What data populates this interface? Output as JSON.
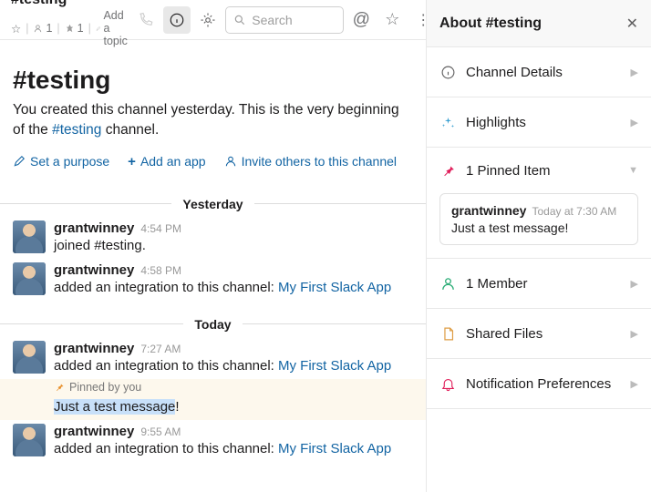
{
  "header": {
    "channel": "#testing",
    "members": "1",
    "pins": "1",
    "add_topic": "Add a topic",
    "search_ph": "Search"
  },
  "hero": {
    "title": "#testing",
    "line1": "You created this channel yesterday. This is the very beginning of the ",
    "chlink": "#testing",
    "line2": " channel.",
    "set_purpose": "Set a purpose",
    "add_app": "Add an app",
    "invite": "Invite others to this channel"
  },
  "dividers": {
    "yesterday": "Yesterday",
    "today": "Today"
  },
  "messages": {
    "m1": {
      "name": "grantwinney",
      "time": "4:54 PM",
      "body": "joined #testing."
    },
    "m2": {
      "name": "grantwinney",
      "time": "4:58 PM",
      "body_a": "added an integration to this channel: ",
      "body_b": "My First Slack App"
    },
    "m3": {
      "name": "grantwinney",
      "time": "7:27 AM",
      "body_a": "added an integration to this channel: ",
      "body_b": "My First Slack App"
    },
    "pin_label": "Pinned by you",
    "pin_text_hl": "Just a test message",
    "pin_text_end": "!",
    "m4": {
      "name": "grantwinney",
      "time": "9:55 AM",
      "body_a": "added an integration to this channel: ",
      "body_b": "My First Slack App"
    }
  },
  "about": {
    "title": "About #testing",
    "details": "Channel Details",
    "highlights": "Highlights",
    "pinned": "1 Pinned Item",
    "pincard": {
      "name": "grantwinney",
      "time": "Today at 7:30 AM",
      "text": "Just a test message!"
    },
    "member": "1 Member",
    "files": "Shared Files",
    "notif": "Notification Preferences"
  }
}
